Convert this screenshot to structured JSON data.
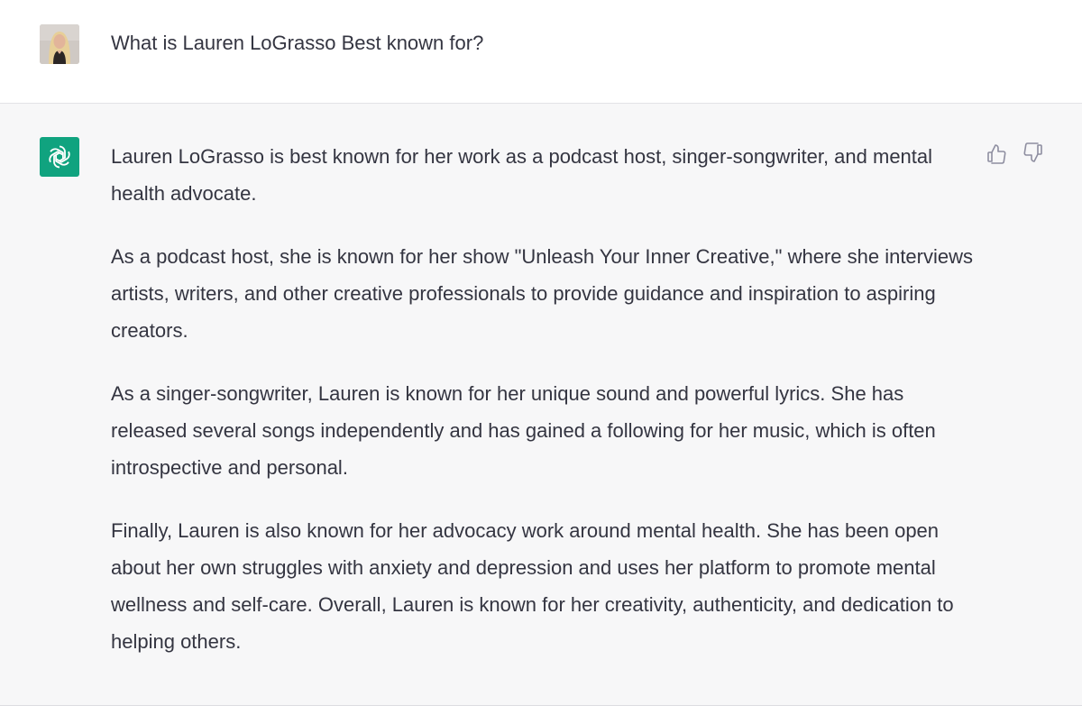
{
  "conversation": {
    "user_message": "What is Lauren LoGrasso Best known for?",
    "user_avatar_icon": "user-photo-avatar",
    "assistant_avatar_icon": "openai-logo-icon",
    "assistant_avatar_color": "#10a37f",
    "assistant_paragraphs": [
      "Lauren LoGrasso is best known for her work as a podcast host, singer-songwriter, and mental health advocate.",
      "As a podcast host, she is known for her show \"Unleash Your Inner Creative,\" where she interviews artists, writers, and other creative professionals to provide guidance and inspiration to aspiring creators.",
      "As a singer-songwriter, Lauren is known for her unique sound and powerful lyrics. She has released several songs independently and has gained a following for her music, which is often introspective and personal.",
      "Finally, Lauren is also known for her advocacy work around mental health. She has been open about her own struggles with anxiety and depression and uses her platform to promote mental wellness and self-care. Overall, Lauren is known for her creativity, authenticity, and dedication to helping others."
    ],
    "feedback_icons": [
      "thumbs-up-icon",
      "thumbs-down-icon"
    ]
  }
}
